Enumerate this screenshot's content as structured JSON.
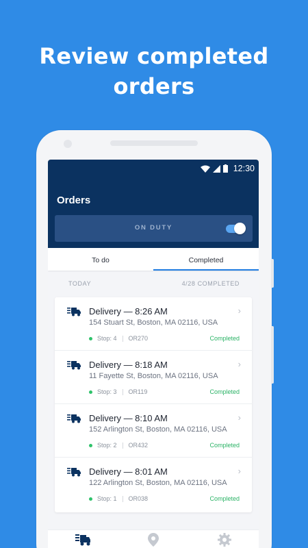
{
  "headline": {
    "line1": "Review completed",
    "line2": "orders"
  },
  "status_bar": {
    "time": "12:30"
  },
  "app": {
    "title": "Orders",
    "duty_label": "ON DUTY",
    "duty_on": true
  },
  "tabs": [
    {
      "label": "To do",
      "active": false
    },
    {
      "label": "Completed",
      "active": true
    }
  ],
  "section": {
    "day": "TODAY",
    "summary": "4/28 COMPLETED"
  },
  "orders": [
    {
      "title": "Delivery — 8:26 AM",
      "address": "154 Stuart St, Boston, MA 02116, USA",
      "stop": "Stop: 4",
      "code": "OR270",
      "status": "Completed"
    },
    {
      "title": "Delivery — 8:18 AM",
      "address": "11 Fayette St, Boston, MA 02116, USA",
      "stop": "Stop: 3",
      "code": "OR119",
      "status": "Completed"
    },
    {
      "title": "Delivery — 8:10 AM",
      "address": "152 Arlington St, Boston, MA 02116, USA",
      "stop": "Stop: 2",
      "code": "OR432",
      "status": "Completed"
    },
    {
      "title": "Delivery — 8:01 AM",
      "address": "122 Arlington St, Boston, MA 02116, USA",
      "stop": "Stop: 1",
      "code": "OR038",
      "status": "Completed"
    }
  ],
  "bottom_nav": [
    {
      "icon": "orders-truck-icon"
    },
    {
      "icon": "location-pin-icon"
    },
    {
      "icon": "gear-icon"
    }
  ],
  "colors": {
    "background": "#2f8be6",
    "appbar": "#0b3260",
    "accent": "#1f7be0",
    "completed": "#2bb366"
  }
}
